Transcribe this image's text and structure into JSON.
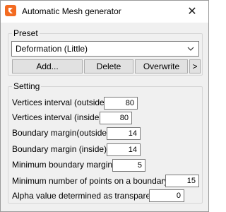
{
  "window": {
    "title": "Automatic Mesh generator",
    "close": "✕"
  },
  "preset": {
    "label": "Preset",
    "selected": "Deformation (Little)",
    "buttons": {
      "add": "Add...",
      "delete": "Delete",
      "overwrite": "Overwrite",
      "more": ">"
    }
  },
  "setting": {
    "label": "Setting",
    "rows": [
      {
        "label": "Vertices interval (outside)",
        "value": "80"
      },
      {
        "label": "Vertices interval (inside)",
        "value": "80"
      },
      {
        "label": "Boundary margin(outside)",
        "value": "14"
      },
      {
        "label": "Boundary margin (inside)",
        "value": "14"
      },
      {
        "label": "Minimum boundary margin",
        "value": "5"
      },
      {
        "label": "Minimum number of points on a boundary",
        "value": "15"
      },
      {
        "label": "Alpha value determined as transparent",
        "value": "0"
      }
    ]
  },
  "colors": {
    "accent": "#f36b21"
  }
}
